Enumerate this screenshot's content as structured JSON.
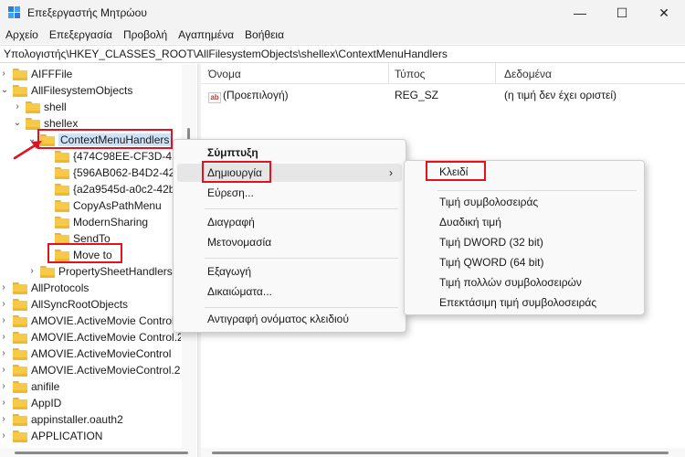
{
  "window": {
    "title": "Επεξεργαστής Μητρώου",
    "minimize_glyph": "—",
    "maximize_glyph": "☐",
    "close_glyph": "✕"
  },
  "menubar": [
    "Αρχείο",
    "Επεξεργασία",
    "Προβολή",
    "Αγαπημένα",
    "Βοήθεια"
  ],
  "address": "Υπολογιστής\\HKEY_CLASSES_ROOT\\AllFilesystemObjects\\shellex\\ContextMenuHandlers",
  "tree": {
    "items": [
      {
        "label": "AIFFFile"
      },
      {
        "label": "AllFilesystemObjects"
      },
      {
        "label": "shell"
      },
      {
        "label": "shellex"
      },
      {
        "label": "ContextMenuHandlers"
      },
      {
        "label": "{474C98EE-CF3D-41f"
      },
      {
        "label": "{596AB062-B4D2-421"
      },
      {
        "label": "{a2a9545d-a0c2-42b"
      },
      {
        "label": "CopyAsPathMenu"
      },
      {
        "label": "ModernSharing"
      },
      {
        "label": "SendTo"
      },
      {
        "label": "Move to"
      },
      {
        "label": "PropertySheetHandlers"
      },
      {
        "label": "AllProtocols"
      },
      {
        "label": "AllSyncRootObjects"
      },
      {
        "label": "AMOVIE.ActiveMovie Control"
      },
      {
        "label": "AMOVIE.ActiveMovie Control.2"
      },
      {
        "label": "AMOVIE.ActiveMovieControl"
      },
      {
        "label": "AMOVIE.ActiveMovieControl.2"
      },
      {
        "label": "anifile"
      },
      {
        "label": "AppID"
      },
      {
        "label": "appinstaller.oauth2"
      },
      {
        "label": "APPLICATION"
      }
    ]
  },
  "list": {
    "columns": [
      "Όνομα",
      "Τύπος",
      "Δεδομένα"
    ],
    "rows": [
      {
        "icon": "string-value-icon",
        "icon_text": "ab",
        "name": "(Προεπιλογή)",
        "type": "REG_SZ",
        "data": "(η τιμή δεν έχει οριστεί)"
      }
    ]
  },
  "context_menu": {
    "collapse": "Σύμπτυξη",
    "new": "Δημιουργία",
    "new_arrow": "›",
    "find": "Εύρεση...",
    "delete": "Διαγραφή",
    "rename": "Μετονομασία",
    "export": "Εξαγωγή",
    "permissions": "Δικαιώματα...",
    "copy_key_name": "Αντιγραφή ονόματος κλειδιού"
  },
  "submenu": {
    "key": "Κλειδί",
    "string_value": "Τιμή συμβολοσειράς",
    "binary_value": "Δυαδική τιμή",
    "dword_value": "Τιμή DWORD (32 bit)",
    "qword_value": "Τιμή QWORD (64 bit)",
    "multi_string_value": "Τιμή πολλών συμβολοσειρών",
    "expandable_string_value": "Επεκτάσιμη τιμή συμβολοσειράς"
  },
  "colors": {
    "highlight_box": "#e0141e",
    "folder": "#f7c948",
    "selection": "#cfe3f7"
  }
}
